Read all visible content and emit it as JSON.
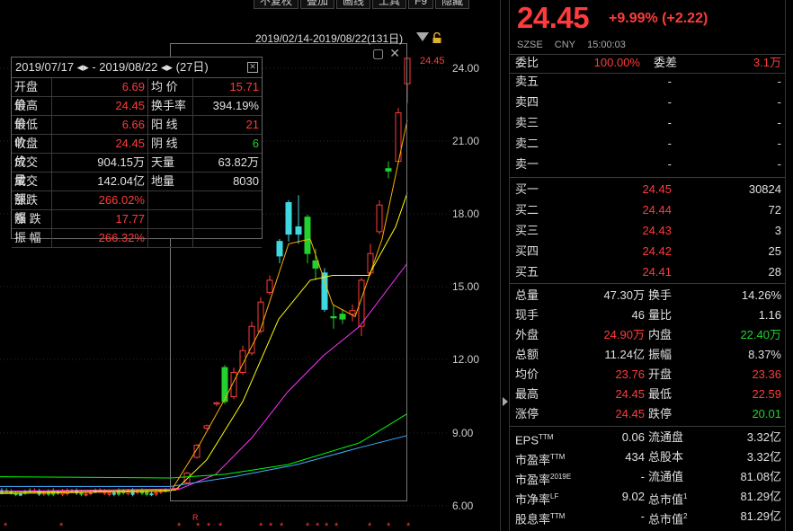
{
  "toolbar": {
    "items": [
      "不复权",
      "叠加",
      "画线",
      "工具",
      "F9",
      "隐藏"
    ]
  },
  "range": {
    "label": "2019/02/14-2019/08/22(131日)"
  },
  "y_axis": {
    "ticks": [
      "24.00",
      "21.00",
      "18.00",
      "15.00",
      "12.00",
      "9.00",
      "6.00"
    ]
  },
  "price_tip": "24.45",
  "info": {
    "title": "2019/07/17 ◂▸ - 2019/08/22 ◂▸ (27日)",
    "rows": [
      {
        "l1": "开盘价",
        "v1": "6.69",
        "c1": "red",
        "l2": "均  价",
        "v2": "15.71",
        "c2": "red"
      },
      {
        "l1": "最高价",
        "v1": "24.45",
        "c1": "red",
        "l2": "换手率",
        "v2": "394.19%",
        "c2": "white"
      },
      {
        "l1": "最低价",
        "v1": "6.66",
        "c1": "red",
        "l2": "阳  线",
        "v2": "21",
        "c2": "red"
      },
      {
        "l1": "收盘价",
        "v1": "24.45",
        "c1": "red",
        "l2": "阴  线",
        "v2": "6",
        "c2": "green"
      },
      {
        "l1": "成交量",
        "v1": "904.15万",
        "c1": "white",
        "l2": "天量",
        "v2": "63.82万",
        "c2": "white"
      },
      {
        "l1": "成交额",
        "v1": "142.04亿",
        "c1": "white",
        "l2": "地量",
        "v2": "8030",
        "c2": "white"
      },
      {
        "l1": "涨跌幅",
        "v1": "266.02%",
        "c1": "red",
        "l2": "",
        "v2": "",
        "c2": "white"
      },
      {
        "l1": "涨  跌",
        "v1": "17.77",
        "c1": "red",
        "l2": "",
        "v2": "",
        "c2": "white"
      },
      {
        "l1": "振  幅",
        "v1": "266.32%",
        "c1": "red",
        "l2": "",
        "v2": "",
        "c2": "white"
      }
    ]
  },
  "markers": [
    "*",
    "*",
    "*",
    "*",
    "*",
    "*",
    "*",
    "*",
    "*",
    "*",
    "*",
    "*",
    "*",
    "*",
    "*",
    "*",
    "*",
    "*"
  ],
  "marker_r": "R",
  "quote": {
    "price": "24.45",
    "change": "+9.99% (+2.22)",
    "exchange": "SZSE",
    "currency": "CNY",
    "time": "15:00:03",
    "weibi_label": "委比",
    "weibi": "100.00%",
    "weicha_label": "委差",
    "weicha": "3.1万",
    "asks": [
      {
        "label": "卖五",
        "price": "-",
        "vol": "-"
      },
      {
        "label": "卖四",
        "price": "-",
        "vol": "-"
      },
      {
        "label": "卖三",
        "price": "-",
        "vol": "-"
      },
      {
        "label": "卖二",
        "price": "-",
        "vol": "-"
      },
      {
        "label": "卖一",
        "price": "-",
        "vol": "-"
      }
    ],
    "bids": [
      {
        "label": "买一",
        "price": "24.45",
        "vol": "30824"
      },
      {
        "label": "买二",
        "price": "24.44",
        "vol": "72"
      },
      {
        "label": "买三",
        "price": "24.43",
        "vol": "3"
      },
      {
        "label": "买四",
        "price": "24.42",
        "vol": "25"
      },
      {
        "label": "买五",
        "price": "24.41",
        "vol": "28"
      }
    ],
    "stats": [
      {
        "l1": "总量",
        "v1": "47.30万",
        "c1": "white",
        "l2": "换手",
        "v2": "14.26%",
        "c2": "white"
      },
      {
        "l1": "现手",
        "v1": "46",
        "c1": "white",
        "l2": "量比",
        "v2": "1.16",
        "c2": "white"
      },
      {
        "l1": "外盘",
        "v1": "24.90万",
        "c1": "red",
        "l2": "内盘",
        "v2": "22.40万",
        "c2": "green"
      },
      {
        "l1": "总额",
        "v1": "11.24亿",
        "c1": "white",
        "l2": "振幅",
        "v2": "8.37%",
        "c2": "white"
      },
      {
        "l1": "均价",
        "v1": "23.76",
        "c1": "red",
        "l2": "开盘",
        "v2": "23.36",
        "c2": "red"
      },
      {
        "l1": "最高",
        "v1": "24.45",
        "c1": "red",
        "l2": "最低",
        "v2": "22.59",
        "c2": "red"
      },
      {
        "l1": "涨停",
        "v1": "24.45",
        "c1": "red",
        "l2": "跌停",
        "v2": "20.01",
        "c2": "green"
      }
    ],
    "fund": [
      {
        "l1": "EPS",
        "s1": "TTM",
        "v1": "0.06",
        "l2": "流通盘",
        "s2": "",
        "v2": "3.32亿"
      },
      {
        "l1": "市盈率",
        "s1": "TTM",
        "v1": "434",
        "l2": "总股本",
        "s2": "",
        "v2": "3.32亿"
      },
      {
        "l1": "市盈率",
        "s1": "2019E",
        "v1": "-",
        "l2": "流通值",
        "s2": "",
        "v2": "81.08亿"
      },
      {
        "l1": "市净率",
        "s1": "LF",
        "v1": "9.02",
        "l2": "总市值",
        "s2": "1",
        "v2": "81.29亿"
      },
      {
        "l1": "股息率",
        "s1": "TTM",
        "v1": "-",
        "l2": "总市值",
        "s2": "2",
        "v2": "81.29亿"
      }
    ]
  },
  "colors": {
    "up": "#ff3b3b",
    "down": "#23d12e",
    "cyan": "#3fd8e0",
    "ma5": "#ffffff",
    "ma10": "#ffff00",
    "ma20": "#ff33ff",
    "ma60": "#00ff00"
  }
}
